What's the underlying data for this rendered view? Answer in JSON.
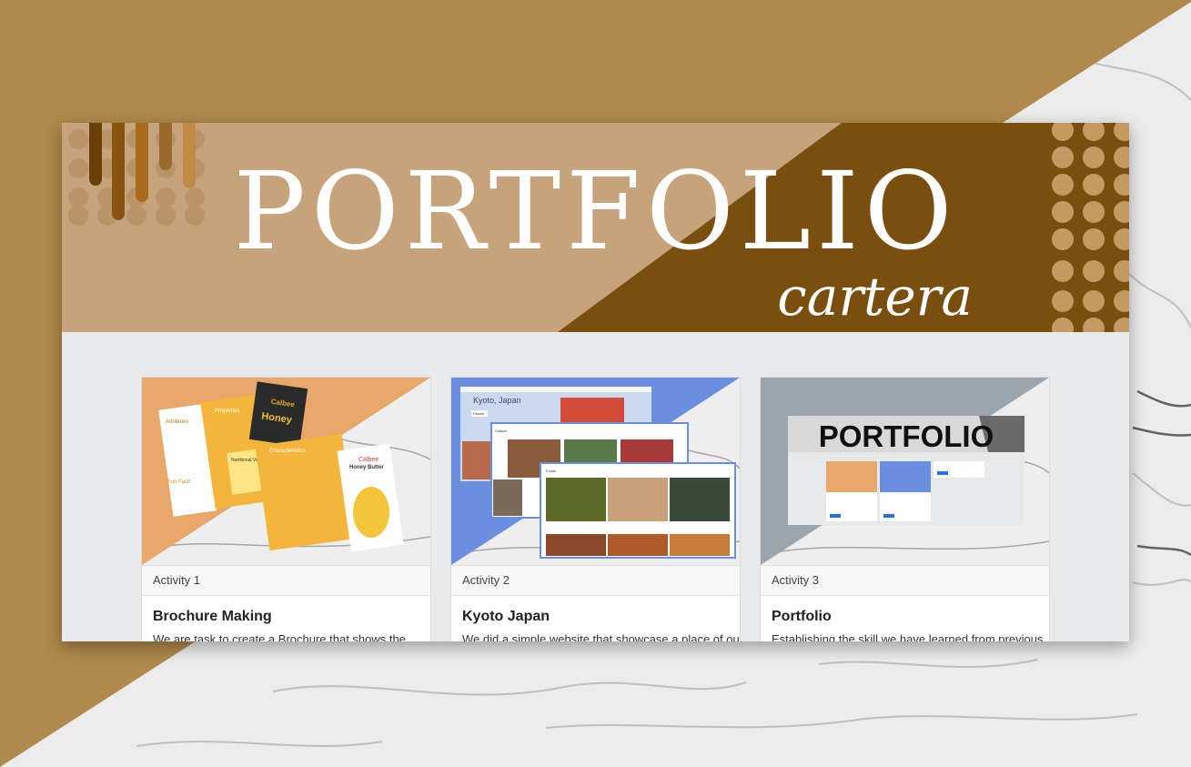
{
  "banner": {
    "title": "PORTFOLIO",
    "subtitle": "cartera"
  },
  "colors": {
    "page_bg": "#b08a4c",
    "banner_light": "#c6a37a",
    "banner_dark": "#7a4e0e",
    "card_orange": "#e8a86b",
    "card_blue": "#6b8fe0",
    "card_gray": "#9aa5ae"
  },
  "cards": [
    {
      "header": "Activity 1",
      "title": "Brochure Making",
      "text": "We are task to create a Brochure that shows the"
    },
    {
      "header": "Activity 2",
      "title": "Kyoto Japan",
      "text": "We did a simple website that showcase a place of our"
    },
    {
      "header": "Activity 3",
      "title": "Portfolio",
      "text": "Establishing the skill we have learned from previous"
    }
  ],
  "thumbnails": {
    "brochure": {
      "section_attributes": "Attributes",
      "section_properties": "Properties",
      "section_nutritional": "Nutritional Value",
      "section_characteristics": "Characteristics",
      "section_funfact": "Fun Fact!",
      "brand": "Calbee",
      "product": "Honey Butter"
    },
    "kyoto": {
      "page_title": "Kyoto, Japan",
      "section_places": "Places",
      "section_culture": "Culture",
      "section_foods": "Foods"
    },
    "portfolio": {
      "mini_title": "PORTFOLIO"
    }
  }
}
